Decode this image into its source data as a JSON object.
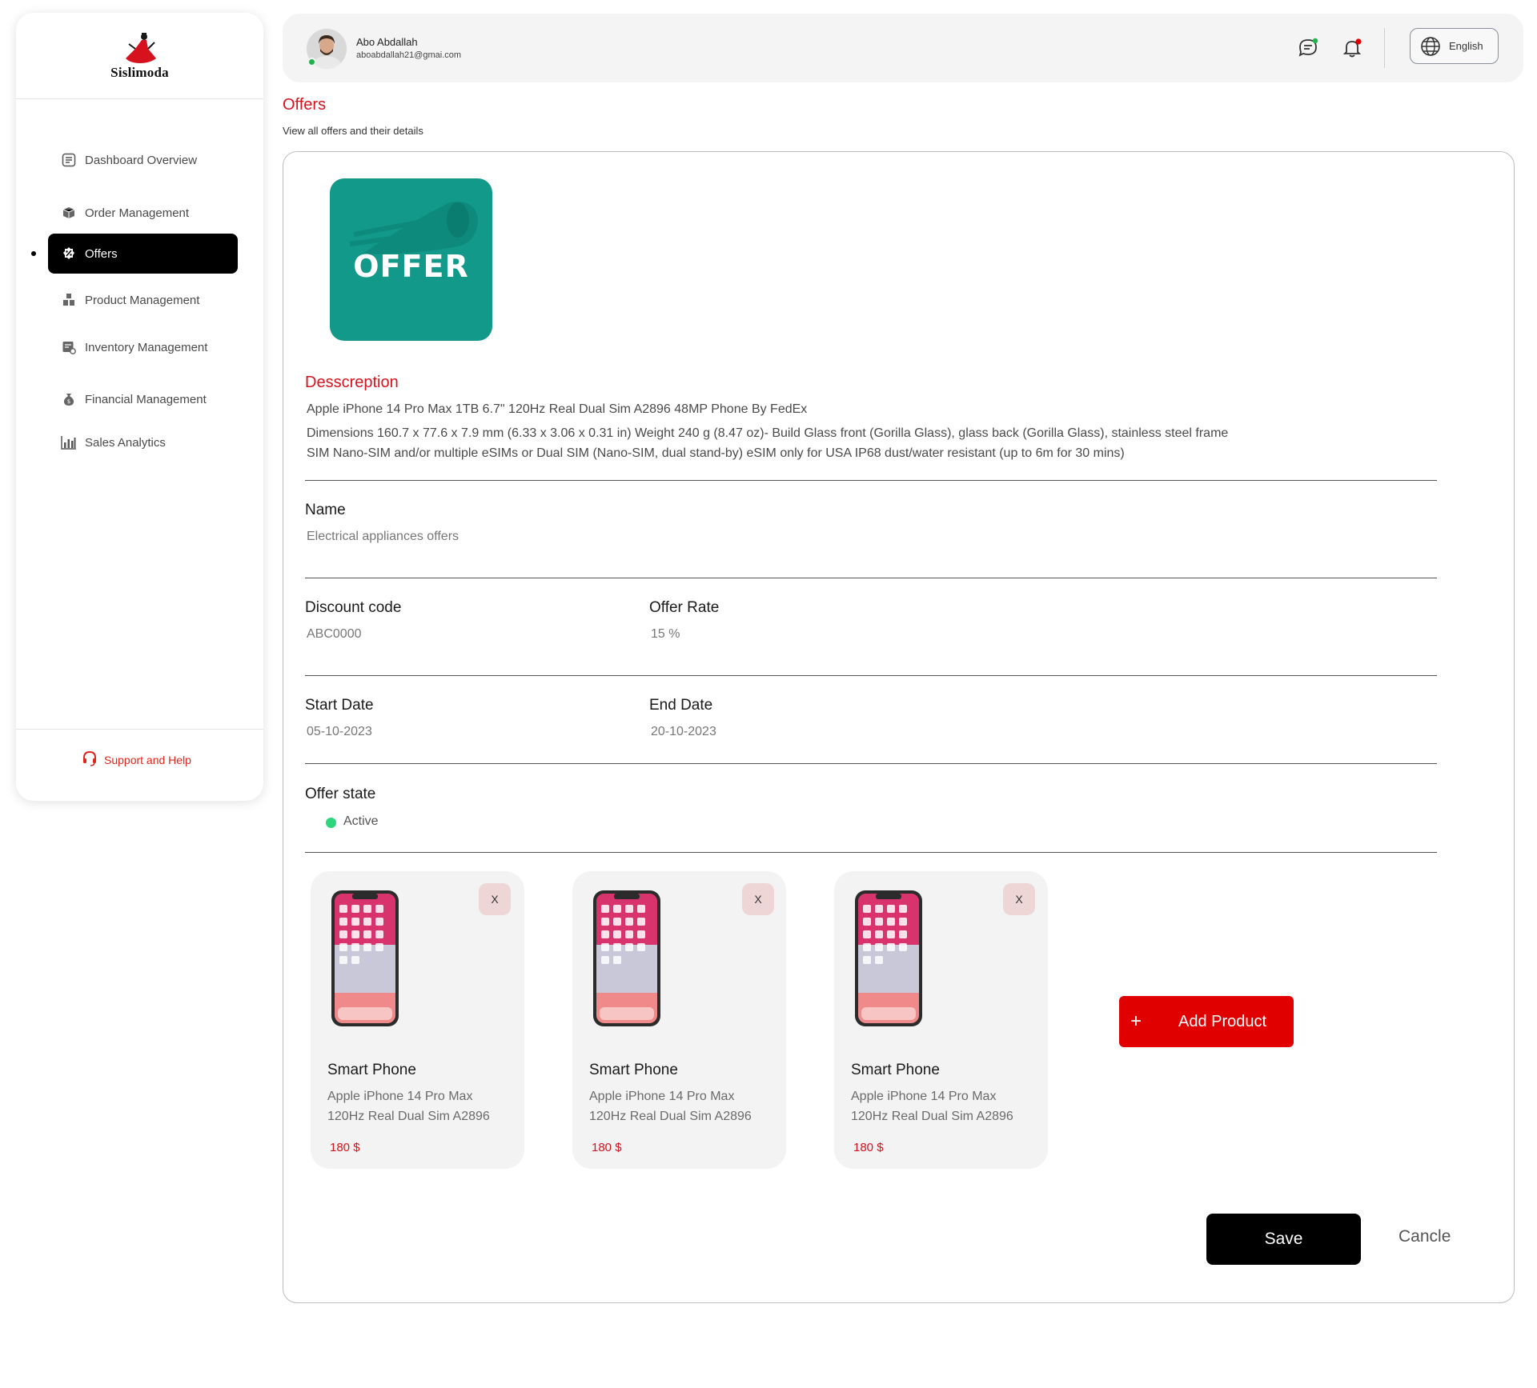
{
  "brand": {
    "name": "Sislimoda"
  },
  "sidebar": {
    "items": [
      {
        "label": "Dashboard Overview",
        "icon": "dashboard-icon"
      },
      {
        "label": "Order Management",
        "icon": "boxes-icon"
      },
      {
        "label": "Offers",
        "icon": "discount-icon",
        "active": true
      },
      {
        "label": "Product Management",
        "icon": "products-icon"
      },
      {
        "label": "Inventory Management",
        "icon": "inventory-icon"
      },
      {
        "label": "Financial Management",
        "icon": "money-bag-icon"
      },
      {
        "label": "Sales Analytics",
        "icon": "chart-icon"
      }
    ],
    "support_label": "Support and Help"
  },
  "header": {
    "user_name": "Abo Abdallah",
    "user_email": "aboabdallah21@gmai.com",
    "language": "English"
  },
  "page": {
    "title": "Offers",
    "subtitle": "View all offers and their details"
  },
  "offer": {
    "image_text": "OFFER",
    "description_title": "Desscreption",
    "description_lines": [
      "Apple iPhone 14 Pro Max 1TB 6.7\" 120Hz Real Dual Sim A2896 48MP Phone By FedEx",
      "Dimensions  160.7 x 77.6 x 7.9 mm (6.33 x 3.06 x 0.31 in) Weight 240 g (8.47 oz)-  Build Glass front (Gorilla Glass), glass back (Gorilla Glass), stainless steel frame",
      "SIM   Nano-SIM and/or multiple eSIMs or Dual SIM (Nano-SIM, dual stand-by) eSIM only for USA    IP68 dust/water resistant (up to 6m for 30 mins)"
    ],
    "name_label": "Name",
    "name_value": "Electrical appliances offers",
    "discount_label": "Discount code",
    "discount_value": "ABC0000",
    "rate_label": "Offer Rate",
    "rate_value": "15 %",
    "start_label": "Start Date",
    "start_value": "05-10-2023",
    "end_label": "End Date",
    "end_value": "20-10-2023",
    "state_label": "Offer state",
    "state_value": "Active"
  },
  "products": [
    {
      "name": "Smart Phone",
      "desc1": "Apple iPhone 14 Pro Max",
      "desc2": "120Hz Real Dual Sim A2896",
      "price": "180 $",
      "remove_label": "X"
    },
    {
      "name": "Smart Phone",
      "desc1": "Apple iPhone 14 Pro Max",
      "desc2": "120Hz Real Dual Sim A2896",
      "price": "180 $",
      "remove_label": "X"
    },
    {
      "name": "Smart Phone",
      "desc1": "Apple iPhone 14 Pro Max",
      "desc2": "120Hz Real Dual Sim A2896",
      "price": "180 $",
      "remove_label": "X"
    }
  ],
  "actions": {
    "add_product_icon": "+",
    "add_product": "Add Product",
    "save": "Save",
    "cancel": "Cancle"
  },
  "colors": {
    "accent_red": "#d6121e",
    "offer_teal": "#12998a",
    "active_green": "#2cd67c"
  }
}
